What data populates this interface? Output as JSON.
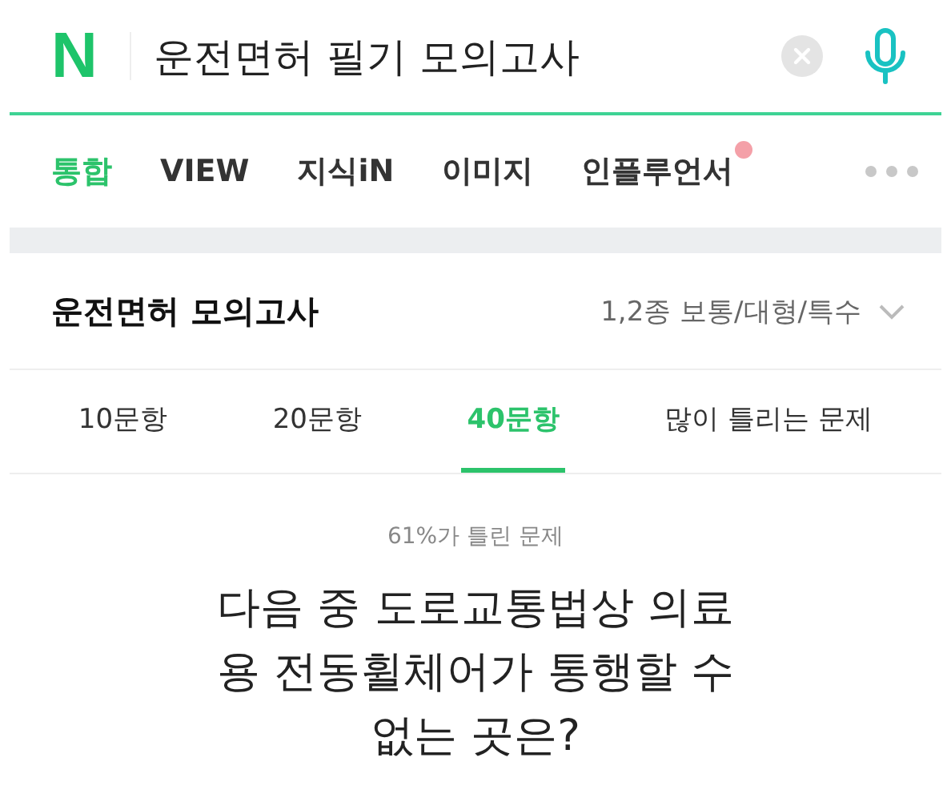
{
  "search": {
    "logo": "N",
    "value": "운전면허 필기 모의고사"
  },
  "tabs": [
    {
      "label": "통합",
      "selected": true,
      "badge": false
    },
    {
      "label": "VIEW",
      "selected": false,
      "badge": false
    },
    {
      "label": "지식iN",
      "selected": false,
      "badge": false
    },
    {
      "label": "이미지",
      "selected": false,
      "badge": false
    },
    {
      "label": "인플루언서",
      "selected": false,
      "badge": true
    }
  ],
  "quiz": {
    "title": "운전면허 모의고사",
    "category": "1,2종 보통/대형/특수",
    "subtabs": [
      {
        "label": "10문항",
        "selected": false
      },
      {
        "label": "20문항",
        "selected": false
      },
      {
        "label": "40문항",
        "selected": true
      },
      {
        "label": "많이 틀리는 문제",
        "selected": false
      }
    ],
    "stat": "61%가 틀린 문제",
    "question": "다음 중 도로교통법상 의료용 전동휠체어가 통행할 수 없는 곳은?"
  }
}
